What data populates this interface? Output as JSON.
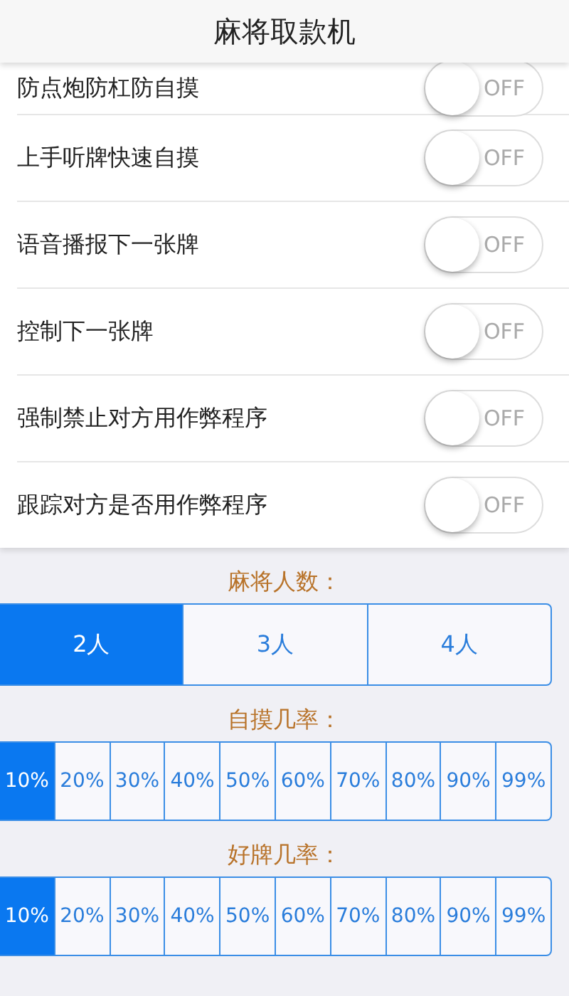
{
  "header": {
    "title": "麻将取款机"
  },
  "settings": [
    {
      "label": "防点炮防杠防自摸",
      "on": false,
      "state_text": "OFF"
    },
    {
      "label": "上手听牌快速自摸",
      "on": false,
      "state_text": "OFF"
    },
    {
      "label": "语音播报下一张牌",
      "on": false,
      "state_text": "OFF"
    },
    {
      "label": "控制下一张牌",
      "on": false,
      "state_text": "OFF"
    },
    {
      "label": "强制禁止对方用作弊程序",
      "on": false,
      "state_text": "OFF"
    },
    {
      "label": "跟踪对方是否用作弊程序",
      "on": false,
      "state_text": "OFF"
    }
  ],
  "groups": [
    {
      "title": "麻将人数：",
      "options": [
        {
          "label": "2人",
          "selected": true
        },
        {
          "label": "3人",
          "selected": false
        },
        {
          "label": "4人",
          "selected": false
        }
      ]
    },
    {
      "title": "自摸几率：",
      "options": [
        {
          "label": "10%",
          "selected": true
        },
        {
          "label": "20%",
          "selected": false
        },
        {
          "label": "30%",
          "selected": false
        },
        {
          "label": "40%",
          "selected": false
        },
        {
          "label": "50%",
          "selected": false
        },
        {
          "label": "60%",
          "selected": false
        },
        {
          "label": "70%",
          "selected": false
        },
        {
          "label": "80%",
          "selected": false
        },
        {
          "label": "90%",
          "selected": false
        },
        {
          "label": "99%",
          "selected": false
        }
      ]
    },
    {
      "title": "好牌几率：",
      "options": [
        {
          "label": "10%",
          "selected": true
        },
        {
          "label": "20%",
          "selected": false
        },
        {
          "label": "30%",
          "selected": false
        },
        {
          "label": "40%",
          "selected": false
        },
        {
          "label": "50%",
          "selected": false
        },
        {
          "label": "60%",
          "selected": false
        },
        {
          "label": "70%",
          "selected": false
        },
        {
          "label": "80%",
          "selected": false
        },
        {
          "label": "90%",
          "selected": false
        },
        {
          "label": "99%",
          "selected": false
        }
      ]
    }
  ]
}
